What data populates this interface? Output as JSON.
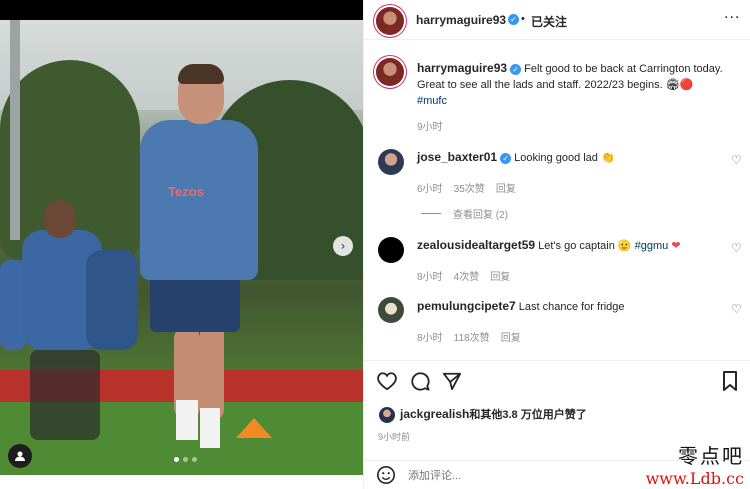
{
  "post": {
    "author": "harrymaguire93",
    "follow_label": "已关注",
    "caption_main": "Felt good to be back at Carrington today. Great to see all the lads and staff. 2022/23 begins. ",
    "caption_hashtag": "#mufc",
    "caption_time": "9小时",
    "caption_emoji": "🏟🔴",
    "more_icon": "more-horizontal-icon"
  },
  "photo": {
    "shirt_sponsor": "Tezos",
    "next_icon": "chevron-right-icon",
    "user_tag_icon": "person-icon",
    "carousel_dots": 3,
    "active_dot": 0
  },
  "comments": [
    {
      "user": "jose_baxter01",
      "verified": true,
      "text": "Looking good lad 👏",
      "time": "6小时",
      "likes": "35次赞",
      "reply": "回复",
      "view_replies": "查看回复 (2)"
    },
    {
      "user": "zealousidealtarget59",
      "verified": false,
      "text": "Let's go captain 🫡 ",
      "hashtag": "#ggmu",
      "emoji": "❤",
      "time": "8小时",
      "likes": "4次赞",
      "reply": "回复"
    },
    {
      "user": "pemulungcipete7",
      "verified": false,
      "text": "Last chance for fridge",
      "time": "8小时",
      "likes": "118次赞",
      "reply": "回复"
    }
  ],
  "likes": {
    "liker": "jackgrealish",
    "summary": "和其他3.8 万位用户赞了",
    "time": "9小时前"
  },
  "comment_box": {
    "placeholder": "添加评论...",
    "emoji_icon": "smiley-icon"
  },
  "watermark": {
    "line1": "零点吧",
    "line2": "www.Ldb.cc"
  },
  "colors": {
    "verified": "#3897f0",
    "link": "#00376b",
    "muted": "#8e8e8e",
    "heart_red": "#ed4956"
  }
}
